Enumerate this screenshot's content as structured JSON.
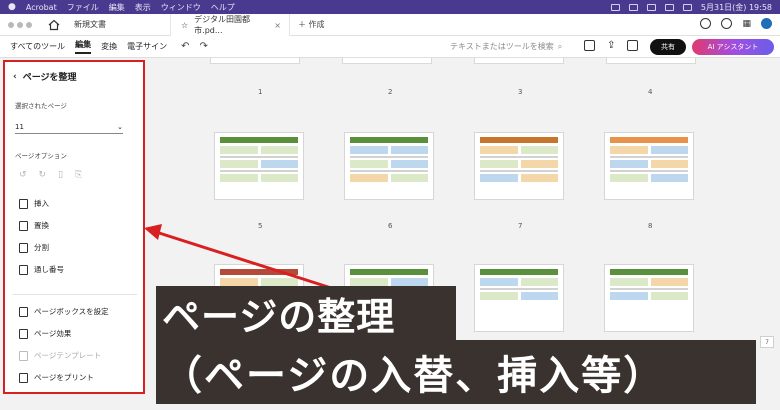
{
  "menubar": {
    "app": "Acrobat",
    "items": [
      "ファイル",
      "編集",
      "表示",
      "ウィンドウ",
      "ヘルプ"
    ],
    "datetime": "5月31日(金) 19:58"
  },
  "tabs": {
    "home_tab": "新規文書",
    "active_tab": "デジタル田園都市.pd...",
    "new_tab": "作成"
  },
  "toolbar": {
    "items": [
      "すべてのツール",
      "編集",
      "変換",
      "電子サイン"
    ],
    "search_placeholder": "テキストまたはツールを検索",
    "share": "共有",
    "ai": "AI アシスタント"
  },
  "panel": {
    "title": "ページを整理",
    "selected_label": "選択されたページ",
    "selected_value": "11",
    "options_label": "ページオプション",
    "actions": [
      "挿入",
      "置換",
      "分割",
      "通し番号"
    ],
    "more": [
      "ページボックスを設定",
      "ページ効果",
      "ページテンプレート",
      "ページをプリント"
    ]
  },
  "pages": {
    "row1": [
      "1",
      "2",
      "3",
      "4"
    ],
    "row2": [
      "5",
      "6",
      "7",
      "8"
    ],
    "side": "7"
  },
  "caption": {
    "line1": "ページの整理",
    "line2": "（ページの入替、挿入等）"
  }
}
